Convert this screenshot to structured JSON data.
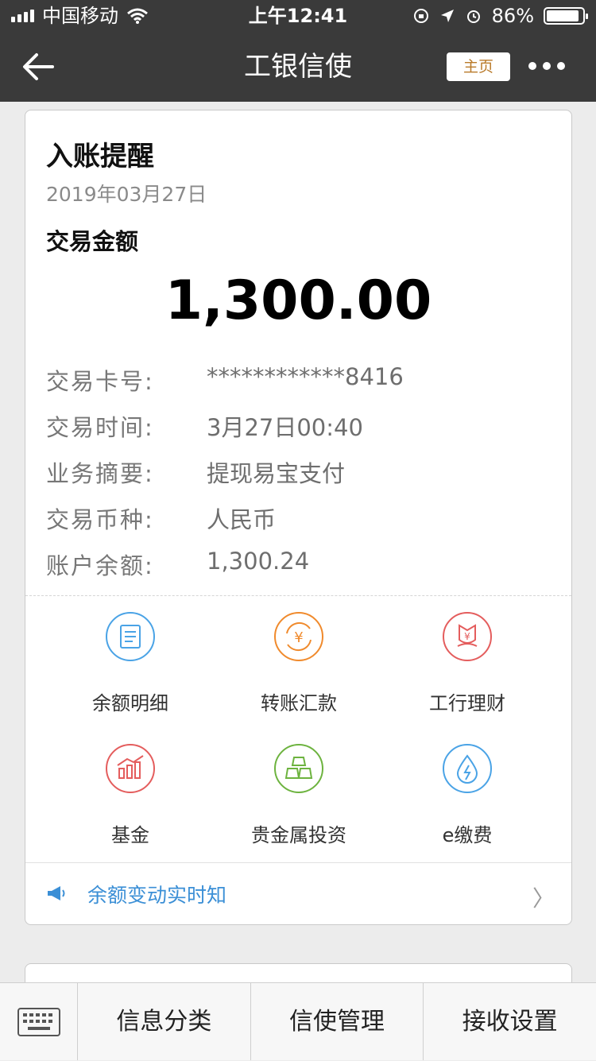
{
  "status": {
    "carrier": "中国移动",
    "time": "上午12:41",
    "battery": "86%",
    "battery_level": 0.86
  },
  "nav": {
    "title": "工银信使",
    "home_label": "主页"
  },
  "card": {
    "title": "入账提醒",
    "date": "2019年03月27日",
    "amount_label": "交易金额",
    "amount": "1,300.00",
    "rows": [
      {
        "key": "交易卡号:",
        "value": "************8416"
      },
      {
        "key": "交易时间:",
        "value": "3月27日00:40"
      },
      {
        "key": "业务摘要:",
        "value": "提现易宝支付"
      },
      {
        "key": "交易币种:",
        "value": "人民币"
      },
      {
        "key": "账户余额:",
        "value": "1,300.24"
      }
    ],
    "services": [
      {
        "label": "余额明细",
        "icon": "document-icon",
        "color": "#4aa3e6"
      },
      {
        "label": "转账汇款",
        "icon": "yuan-transfer-icon",
        "color": "#f08a2c"
      },
      {
        "label": "工行理财",
        "icon": "flower-yuan-icon",
        "color": "#e45d5d"
      },
      {
        "label": "基金",
        "icon": "bar-chart-icon",
        "color": "#e45d5d"
      },
      {
        "label": "贵金属投资",
        "icon": "gold-bars-icon",
        "color": "#6db33f"
      },
      {
        "label": "e缴费",
        "icon": "water-drop-icon",
        "color": "#4aa3e6"
      }
    ],
    "notice": "余额变动实时知"
  },
  "bottom_menu": [
    "信息分类",
    "信使管理",
    "接收设置"
  ]
}
